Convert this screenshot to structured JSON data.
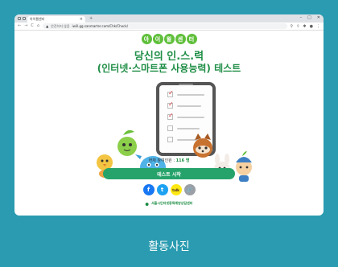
{
  "browser": {
    "tab_title": "아이윌센터",
    "tab_close": "×",
    "new_tab": "+",
    "window_controls": [
      "–",
      "□",
      "✕"
    ],
    "nav": [
      "←",
      "→",
      "C",
      "⌂"
    ],
    "security_label": "안전하지 않음",
    "url": "iwill.gg.sanmarter.com/Chk/Check/",
    "toolbar_icons": [
      "search-icon",
      "share-icon",
      "extension-icon",
      "profile-icon",
      "menu-icon"
    ]
  },
  "page": {
    "badges": [
      "아",
      "이",
      "윌",
      "센",
      "터"
    ],
    "title_line1": "당신의 인.스.력",
    "title_line2": "(인터넷·스마트폰 사용능력) 테스트",
    "participants_label": "현재 참여인원 : ",
    "participants_value": "116 명",
    "start_button": "테스트 시작",
    "share": {
      "facebook": "f",
      "twitter": "t",
      "kakao": "talk",
      "link": "🔗"
    },
    "footer_org": "서울시인터넷중독예방상담센터"
  },
  "caption": "활동사진",
  "colors": {
    "background": "#2a9bb0",
    "brand_green": "#1f8e46",
    "button_green": "#26a36a",
    "badge_green": "#5fbf3a"
  }
}
